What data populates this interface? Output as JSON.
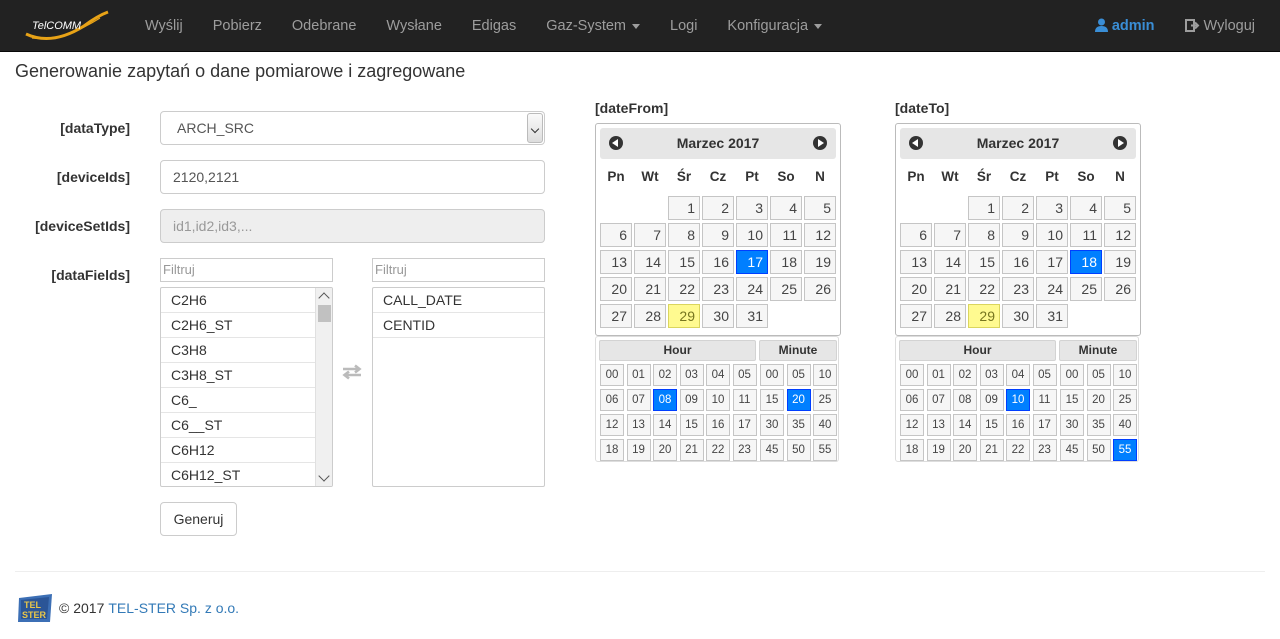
{
  "nav": {
    "brand": "TelCOMM",
    "items": [
      "Wyślij",
      "Pobierz",
      "Odebrane",
      "Wysłane",
      "Edigas",
      "Gaz-System",
      "Logi",
      "Konfiguracja"
    ],
    "user": "admin",
    "logout": "Wyloguj"
  },
  "page": {
    "title": "Generowanie zapytań o dane pomiarowe i zagregowane"
  },
  "form": {
    "dataType": {
      "label": "[dataType]",
      "value": "ARCH_SRC"
    },
    "deviceIds": {
      "label": "[deviceIds]",
      "value": "2120,2121"
    },
    "deviceSetIds": {
      "label": "[deviceSetIds]",
      "placeholder": "id1,id2,id3,..."
    },
    "dataFields": {
      "label": "[dataFields]",
      "filter_placeholder": "Filtruj",
      "available": [
        "C2H6",
        "C2H6_ST",
        "C3H8",
        "C3H8_ST",
        "C6_",
        "C6__ST",
        "C6H12",
        "C6H12_ST"
      ],
      "selected": [
        "CALL_DATE",
        "CENTID"
      ]
    },
    "submit": "Generuj"
  },
  "dateFrom": {
    "label": "[dateFrom]",
    "month": "Marzec 2017",
    "weekdays": [
      "Pn",
      "Wt",
      "Śr",
      "Cz",
      "Pt",
      "So",
      "N"
    ],
    "selected_day": 17,
    "today": 29,
    "hour_label": "Hour",
    "minute_label": "Minute",
    "selected_hour": "08",
    "selected_minute": "20"
  },
  "dateTo": {
    "label": "[dateTo]",
    "month": "Marzec 2017",
    "weekdays": [
      "Pn",
      "Wt",
      "Śr",
      "Cz",
      "Pt",
      "So",
      "N"
    ],
    "selected_day": 18,
    "today": 29,
    "hour_label": "Hour",
    "minute_label": "Minute",
    "selected_hour": "10",
    "selected_minute": "55"
  },
  "footer": {
    "copyright": "© 2017",
    "company": "TEL-STER Sp. z o.o.",
    "logo_text": "TEL STER"
  }
}
